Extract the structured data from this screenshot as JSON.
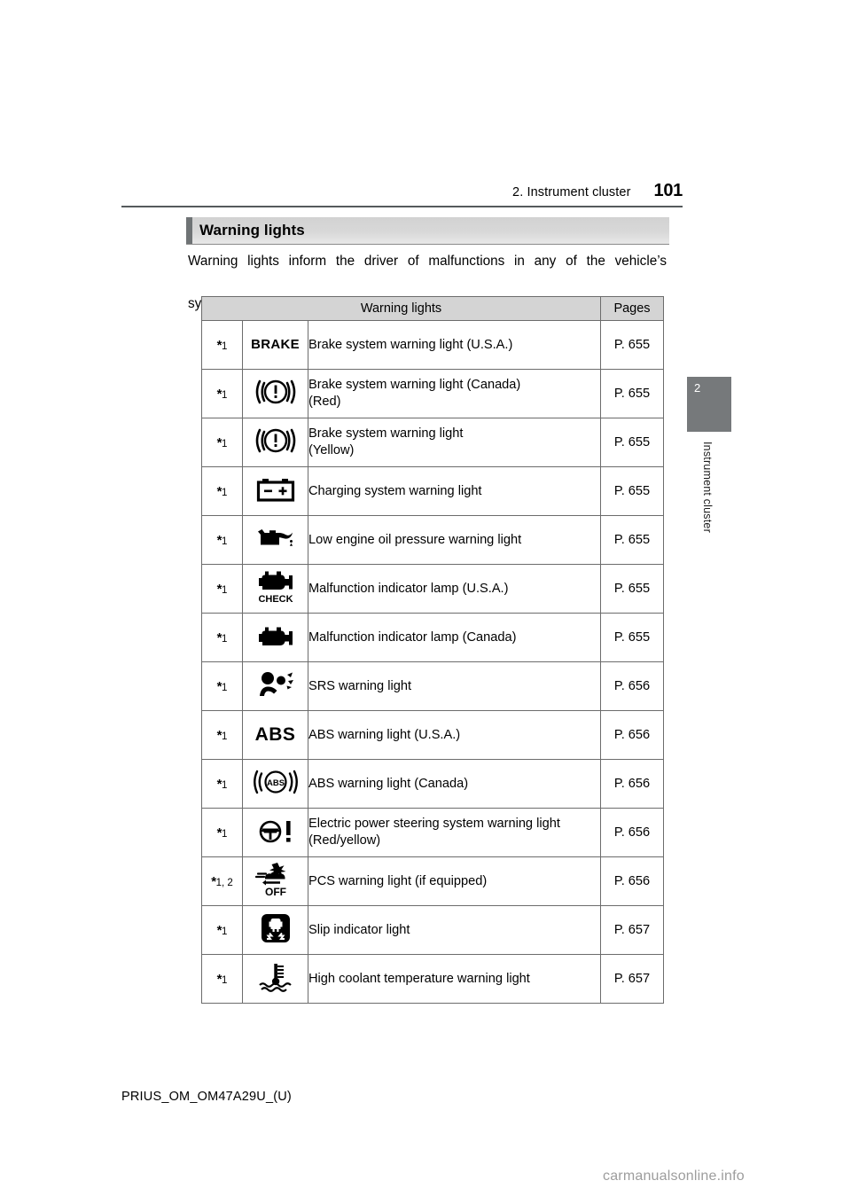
{
  "header": {
    "chapter": "2. Instrument cluster",
    "page_number": "101"
  },
  "section": {
    "title": "Warning lights",
    "intro_line1": "Warning lights inform the driver of malfunctions in any of the vehicle’s",
    "intro_line2": "systems."
  },
  "table": {
    "columns": {
      "warning_lights": "Warning lights",
      "pages": "Pages"
    },
    "rows": [
      {
        "footnote": "1",
        "icon": "brake-text-icon",
        "icon_text": "BRAKE",
        "description": "Brake system warning light (U.S.A.)",
        "page": "P. 655"
      },
      {
        "footnote": "1",
        "icon": "brake-circle-icon",
        "icon_text": "",
        "description": "Brake system warning light (Canada)\n(Red)",
        "page": "P. 655"
      },
      {
        "footnote": "1",
        "icon": "brake-circle-icon",
        "icon_text": "",
        "description": "Brake system warning light\n(Yellow)",
        "page": "P. 655"
      },
      {
        "footnote": "1",
        "icon": "battery-charging-icon",
        "icon_text": "",
        "description": "Charging system warning light",
        "page": "P. 655"
      },
      {
        "footnote": "1",
        "icon": "oil-can-icon",
        "icon_text": "",
        "description": "Low engine oil pressure warning light",
        "page": "P. 655"
      },
      {
        "footnote": "1",
        "icon": "check-engine-check-icon",
        "icon_text": "CHECK",
        "description": "Malfunction indicator lamp (U.S.A.)",
        "page": "P. 655"
      },
      {
        "footnote": "1",
        "icon": "check-engine-icon",
        "icon_text": "",
        "description": "Malfunction indicator lamp (Canada)",
        "page": "P. 655"
      },
      {
        "footnote": "1",
        "icon": "srs-airbag-icon",
        "icon_text": "",
        "description": "SRS warning light",
        "page": "P. 656"
      },
      {
        "footnote": "1",
        "icon": "abs-text-icon",
        "icon_text": "ABS",
        "description": "ABS warning light (U.S.A.)",
        "page": "P. 656"
      },
      {
        "footnote": "1",
        "icon": "abs-circle-icon",
        "icon_text": "ABS",
        "description": "ABS warning light (Canada)",
        "page": "P. 656"
      },
      {
        "footnote": "1",
        "icon": "power-steering-icon",
        "icon_text": "",
        "description": "Electric power steering system warning light\n(Red/yellow)",
        "page": "P. 656"
      },
      {
        "footnote": "1, 2",
        "icon": "pcs-off-icon",
        "icon_text": "OFF",
        "description": "PCS warning light (if equipped)",
        "page": "P. 656"
      },
      {
        "footnote": "1",
        "icon": "slip-indicator-icon",
        "icon_text": "",
        "description": "Slip indicator light",
        "page": "P. 657"
      },
      {
        "footnote": "1",
        "icon": "coolant-temperature-icon",
        "icon_text": "",
        "description": "High coolant temperature warning light",
        "page": "P. 657"
      }
    ]
  },
  "chapter_tab": {
    "number": "2",
    "label": "Instrument cluster"
  },
  "footer": {
    "document_code": "PRIUS_OM_OM47A29U_(U)",
    "watermark": "carmanualsonline.info"
  },
  "colors": {
    "rule": "#555a5c",
    "section_bar": "#d8d8d8",
    "section_tick": "#6f7375",
    "table_header_bg": "#d4d4d4",
    "table_border": "#6c6c6c",
    "chapter_tab_bg": "#76797b",
    "watermark": "#9d9d9d"
  }
}
